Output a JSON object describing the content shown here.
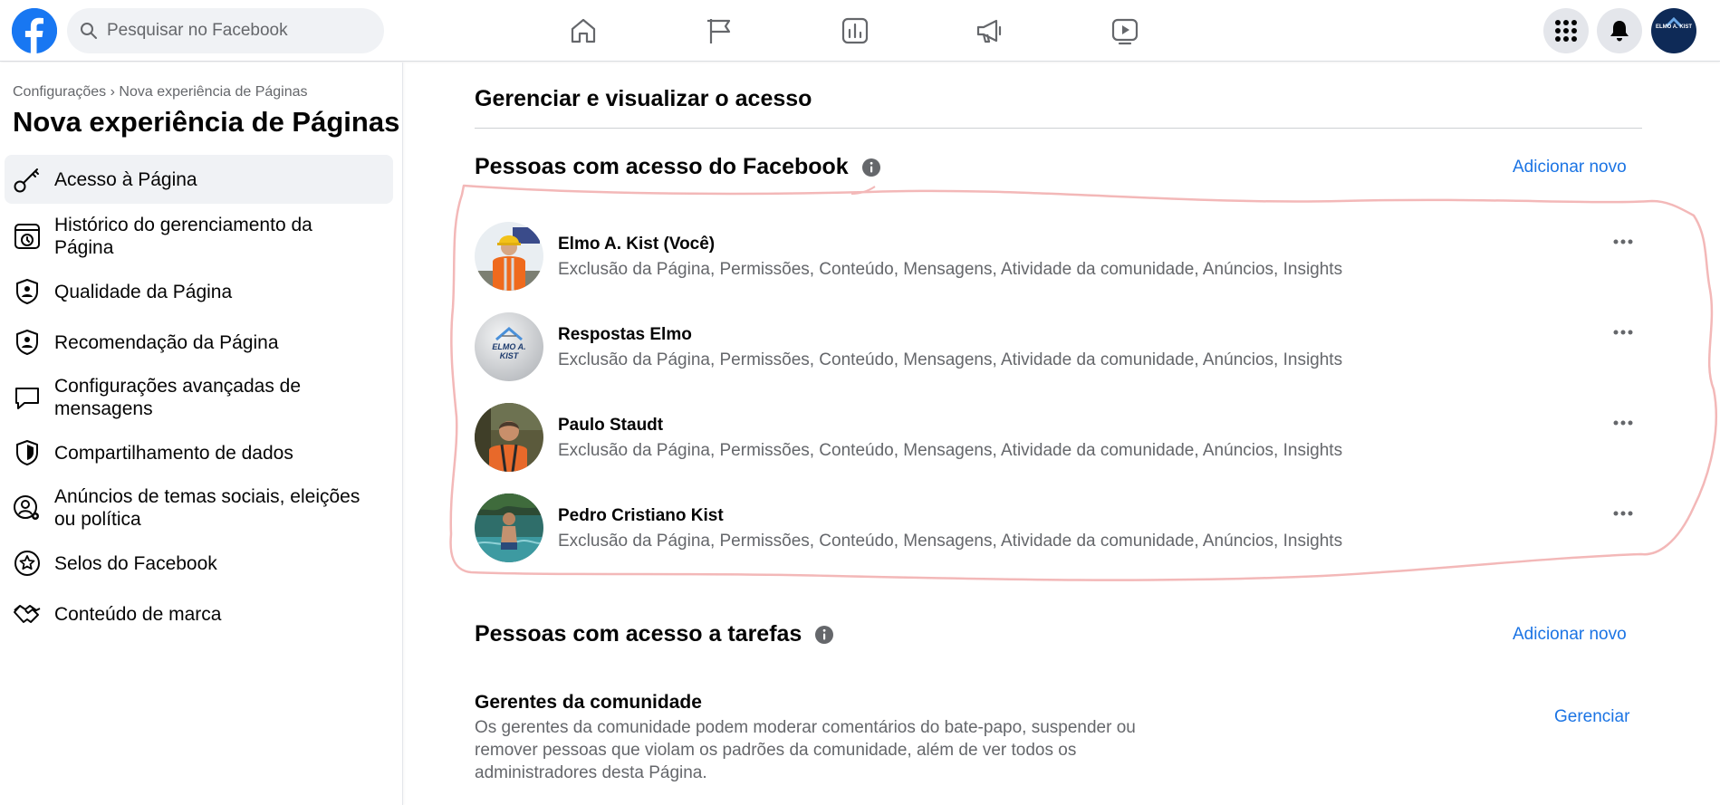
{
  "topbar": {
    "search_placeholder": "Pesquisar no Facebook",
    "nav_icons": [
      "home-icon",
      "pages-flag-icon",
      "insights-chart-icon",
      "ads-megaphone-icon",
      "watch-video-icon"
    ],
    "profile_avatar_text": "ELMO A. KIST"
  },
  "sidebar": {
    "breadcrumb": "Configurações › Nova experiência de Páginas",
    "title": "Nova experiência de Páginas",
    "items": [
      {
        "label": "Acesso à Página",
        "icon": "key-icon",
        "active": true
      },
      {
        "label": "Histórico do gerenciamento da Página",
        "icon": "history-icon"
      },
      {
        "label": "Qualidade da Página",
        "icon": "shield-person-icon"
      },
      {
        "label": "Recomendação da Página",
        "icon": "shield-person-icon"
      },
      {
        "label": "Configurações avançadas de mensagens",
        "icon": "chat-bubble-icon"
      },
      {
        "label": "Compartilhamento de dados",
        "icon": "shield-icon"
      },
      {
        "label": "Anúncios de temas sociais, eleições ou política",
        "icon": "person-gear-icon"
      },
      {
        "label": "Selos do Facebook",
        "icon": "star-badge-icon"
      },
      {
        "label": "Conteúdo de marca",
        "icon": "handshake-icon"
      }
    ]
  },
  "main": {
    "heading": "Gerenciar e visualizar o acesso",
    "facebook_access": {
      "title": "Pessoas com acesso do Facebook",
      "add_label": "Adicionar novo",
      "people": [
        {
          "name": "Elmo A. Kist (Você)",
          "permissions": "Exclusão da Página, Permissões, Conteúdo, Mensagens, Atividade da comunidade, Anúncios, Insights"
        },
        {
          "name": "Respostas Elmo",
          "permissions": "Exclusão da Página, Permissões, Conteúdo, Mensagens, Atividade da comunidade, Anúncios, Insights",
          "logo_text": "ELMO A. KIST"
        },
        {
          "name": "Paulo Staudt",
          "permissions": "Exclusão da Página, Permissões, Conteúdo, Mensagens, Atividade da comunidade, Anúncios, Insights"
        },
        {
          "name": "Pedro Cristiano Kist",
          "permissions": "Exclusão da Página, Permissões, Conteúdo, Mensagens, Atividade da comunidade, Anúncios, Insights"
        }
      ]
    },
    "task_access": {
      "title": "Pessoas com acesso a tarefas",
      "add_label": "Adicionar novo"
    },
    "community_managers": {
      "title": "Gerentes da comunidade",
      "description": "Os gerentes da comunidade podem moderar comentários do bate-papo, suspender ou remover pessoas que violam os padrões da comunidade, além de ver todos os administradores desta Página.",
      "manage_label": "Gerenciar"
    }
  },
  "colors": {
    "brand": "#1877f2",
    "link": "#1b74e4",
    "secondary_text": "#65676b",
    "annotation": "#f3b8b8"
  }
}
